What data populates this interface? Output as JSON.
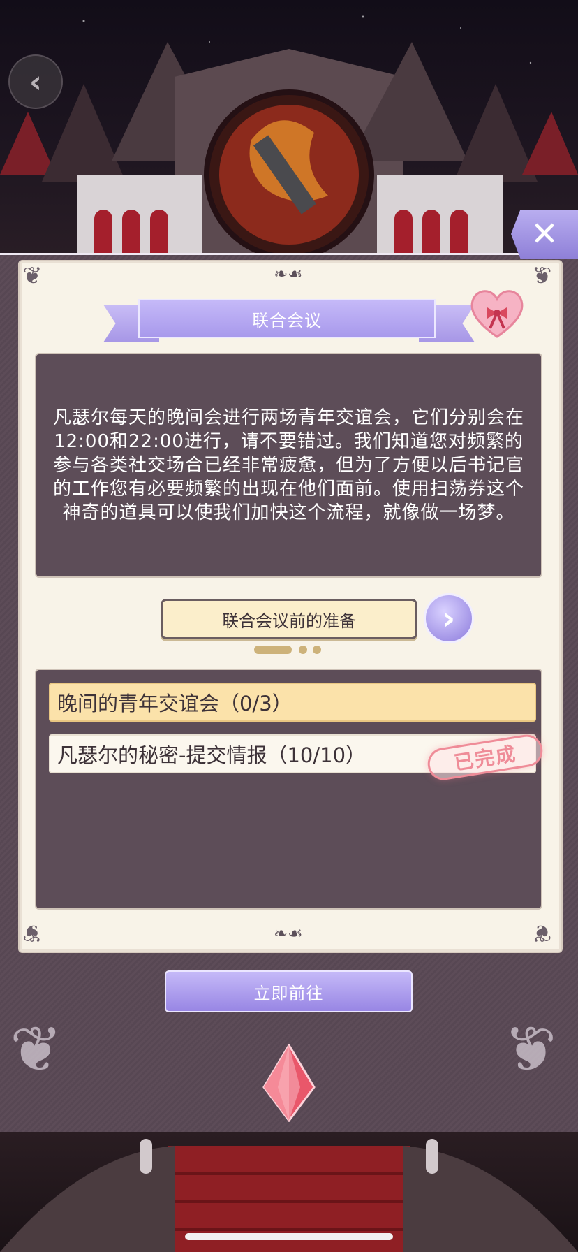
{
  "header": {
    "back_icon": "chevron-left",
    "close_icon": "x"
  },
  "dialog": {
    "title": "联合会议",
    "description": "凡瑟尔每天的晚间会进行两场青年交谊会，它们分别会在12:00和22:00进行，请不要错过。我们知道您对频繁的参与各类社交场合已经非常疲惫，但为了方便以后书记官的工作您有必要频繁的出现在他们面前。使用扫荡券这个神奇的道具可以使我们加快这个流程，就像做一场梦。",
    "prep_button": "联合会议前的准备",
    "page_indicator": {
      "count": 3,
      "current": 1
    },
    "tasks": [
      {
        "label": "晚间的青年交谊会（0/3）",
        "completed": false
      },
      {
        "label": "凡瑟尔的秘密-提交情报（10/10）",
        "completed": true,
        "stamp": "已完成"
      }
    ],
    "go_button": "立即前往"
  },
  "colors": {
    "accent": "#a899ec",
    "panel_dark": "#5d4d58",
    "card_bg": "#f8f3e8",
    "task_highlight": "#fbe2aa",
    "stamp": "#ef8c98"
  }
}
